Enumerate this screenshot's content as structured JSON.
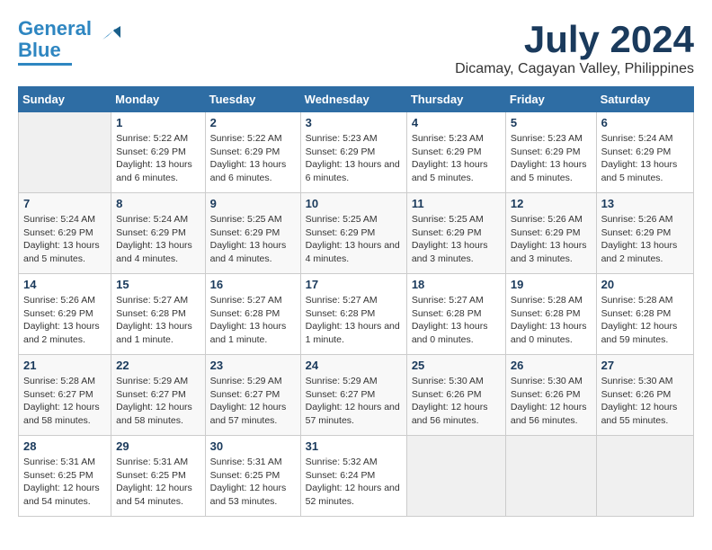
{
  "header": {
    "logo_line1": "General",
    "logo_line2": "Blue",
    "month_title": "July 2024",
    "location": "Dicamay, Cagayan Valley, Philippines"
  },
  "weekdays": [
    "Sunday",
    "Monday",
    "Tuesday",
    "Wednesday",
    "Thursday",
    "Friday",
    "Saturday"
  ],
  "weeks": [
    [
      {
        "day": "",
        "sunrise": "",
        "sunset": "",
        "daylight": ""
      },
      {
        "day": "1",
        "sunrise": "Sunrise: 5:22 AM",
        "sunset": "Sunset: 6:29 PM",
        "daylight": "Daylight: 13 hours and 6 minutes."
      },
      {
        "day": "2",
        "sunrise": "Sunrise: 5:22 AM",
        "sunset": "Sunset: 6:29 PM",
        "daylight": "Daylight: 13 hours and 6 minutes."
      },
      {
        "day": "3",
        "sunrise": "Sunrise: 5:23 AM",
        "sunset": "Sunset: 6:29 PM",
        "daylight": "Daylight: 13 hours and 6 minutes."
      },
      {
        "day": "4",
        "sunrise": "Sunrise: 5:23 AM",
        "sunset": "Sunset: 6:29 PM",
        "daylight": "Daylight: 13 hours and 5 minutes."
      },
      {
        "day": "5",
        "sunrise": "Sunrise: 5:23 AM",
        "sunset": "Sunset: 6:29 PM",
        "daylight": "Daylight: 13 hours and 5 minutes."
      },
      {
        "day": "6",
        "sunrise": "Sunrise: 5:24 AM",
        "sunset": "Sunset: 6:29 PM",
        "daylight": "Daylight: 13 hours and 5 minutes."
      }
    ],
    [
      {
        "day": "7",
        "sunrise": "Sunrise: 5:24 AM",
        "sunset": "Sunset: 6:29 PM",
        "daylight": "Daylight: 13 hours and 5 minutes."
      },
      {
        "day": "8",
        "sunrise": "Sunrise: 5:24 AM",
        "sunset": "Sunset: 6:29 PM",
        "daylight": "Daylight: 13 hours and 4 minutes."
      },
      {
        "day": "9",
        "sunrise": "Sunrise: 5:25 AM",
        "sunset": "Sunset: 6:29 PM",
        "daylight": "Daylight: 13 hours and 4 minutes."
      },
      {
        "day": "10",
        "sunrise": "Sunrise: 5:25 AM",
        "sunset": "Sunset: 6:29 PM",
        "daylight": "Daylight: 13 hours and 4 minutes."
      },
      {
        "day": "11",
        "sunrise": "Sunrise: 5:25 AM",
        "sunset": "Sunset: 6:29 PM",
        "daylight": "Daylight: 13 hours and 3 minutes."
      },
      {
        "day": "12",
        "sunrise": "Sunrise: 5:26 AM",
        "sunset": "Sunset: 6:29 PM",
        "daylight": "Daylight: 13 hours and 3 minutes."
      },
      {
        "day": "13",
        "sunrise": "Sunrise: 5:26 AM",
        "sunset": "Sunset: 6:29 PM",
        "daylight": "Daylight: 13 hours and 2 minutes."
      }
    ],
    [
      {
        "day": "14",
        "sunrise": "Sunrise: 5:26 AM",
        "sunset": "Sunset: 6:29 PM",
        "daylight": "Daylight: 13 hours and 2 minutes."
      },
      {
        "day": "15",
        "sunrise": "Sunrise: 5:27 AM",
        "sunset": "Sunset: 6:28 PM",
        "daylight": "Daylight: 13 hours and 1 minute."
      },
      {
        "day": "16",
        "sunrise": "Sunrise: 5:27 AM",
        "sunset": "Sunset: 6:28 PM",
        "daylight": "Daylight: 13 hours and 1 minute."
      },
      {
        "day": "17",
        "sunrise": "Sunrise: 5:27 AM",
        "sunset": "Sunset: 6:28 PM",
        "daylight": "Daylight: 13 hours and 1 minute."
      },
      {
        "day": "18",
        "sunrise": "Sunrise: 5:27 AM",
        "sunset": "Sunset: 6:28 PM",
        "daylight": "Daylight: 13 hours and 0 minutes."
      },
      {
        "day": "19",
        "sunrise": "Sunrise: 5:28 AM",
        "sunset": "Sunset: 6:28 PM",
        "daylight": "Daylight: 13 hours and 0 minutes."
      },
      {
        "day": "20",
        "sunrise": "Sunrise: 5:28 AM",
        "sunset": "Sunset: 6:28 PM",
        "daylight": "Daylight: 12 hours and 59 minutes."
      }
    ],
    [
      {
        "day": "21",
        "sunrise": "Sunrise: 5:28 AM",
        "sunset": "Sunset: 6:27 PM",
        "daylight": "Daylight: 12 hours and 58 minutes."
      },
      {
        "day": "22",
        "sunrise": "Sunrise: 5:29 AM",
        "sunset": "Sunset: 6:27 PM",
        "daylight": "Daylight: 12 hours and 58 minutes."
      },
      {
        "day": "23",
        "sunrise": "Sunrise: 5:29 AM",
        "sunset": "Sunset: 6:27 PM",
        "daylight": "Daylight: 12 hours and 57 minutes."
      },
      {
        "day": "24",
        "sunrise": "Sunrise: 5:29 AM",
        "sunset": "Sunset: 6:27 PM",
        "daylight": "Daylight: 12 hours and 57 minutes."
      },
      {
        "day": "25",
        "sunrise": "Sunrise: 5:30 AM",
        "sunset": "Sunset: 6:26 PM",
        "daylight": "Daylight: 12 hours and 56 minutes."
      },
      {
        "day": "26",
        "sunrise": "Sunrise: 5:30 AM",
        "sunset": "Sunset: 6:26 PM",
        "daylight": "Daylight: 12 hours and 56 minutes."
      },
      {
        "day": "27",
        "sunrise": "Sunrise: 5:30 AM",
        "sunset": "Sunset: 6:26 PM",
        "daylight": "Daylight: 12 hours and 55 minutes."
      }
    ],
    [
      {
        "day": "28",
        "sunrise": "Sunrise: 5:31 AM",
        "sunset": "Sunset: 6:25 PM",
        "daylight": "Daylight: 12 hours and 54 minutes."
      },
      {
        "day": "29",
        "sunrise": "Sunrise: 5:31 AM",
        "sunset": "Sunset: 6:25 PM",
        "daylight": "Daylight: 12 hours and 54 minutes."
      },
      {
        "day": "30",
        "sunrise": "Sunrise: 5:31 AM",
        "sunset": "Sunset: 6:25 PM",
        "daylight": "Daylight: 12 hours and 53 minutes."
      },
      {
        "day": "31",
        "sunrise": "Sunrise: 5:32 AM",
        "sunset": "Sunset: 6:24 PM",
        "daylight": "Daylight: 12 hours and 52 minutes."
      },
      {
        "day": "",
        "sunrise": "",
        "sunset": "",
        "daylight": ""
      },
      {
        "day": "",
        "sunrise": "",
        "sunset": "",
        "daylight": ""
      },
      {
        "day": "",
        "sunrise": "",
        "sunset": "",
        "daylight": ""
      }
    ]
  ]
}
